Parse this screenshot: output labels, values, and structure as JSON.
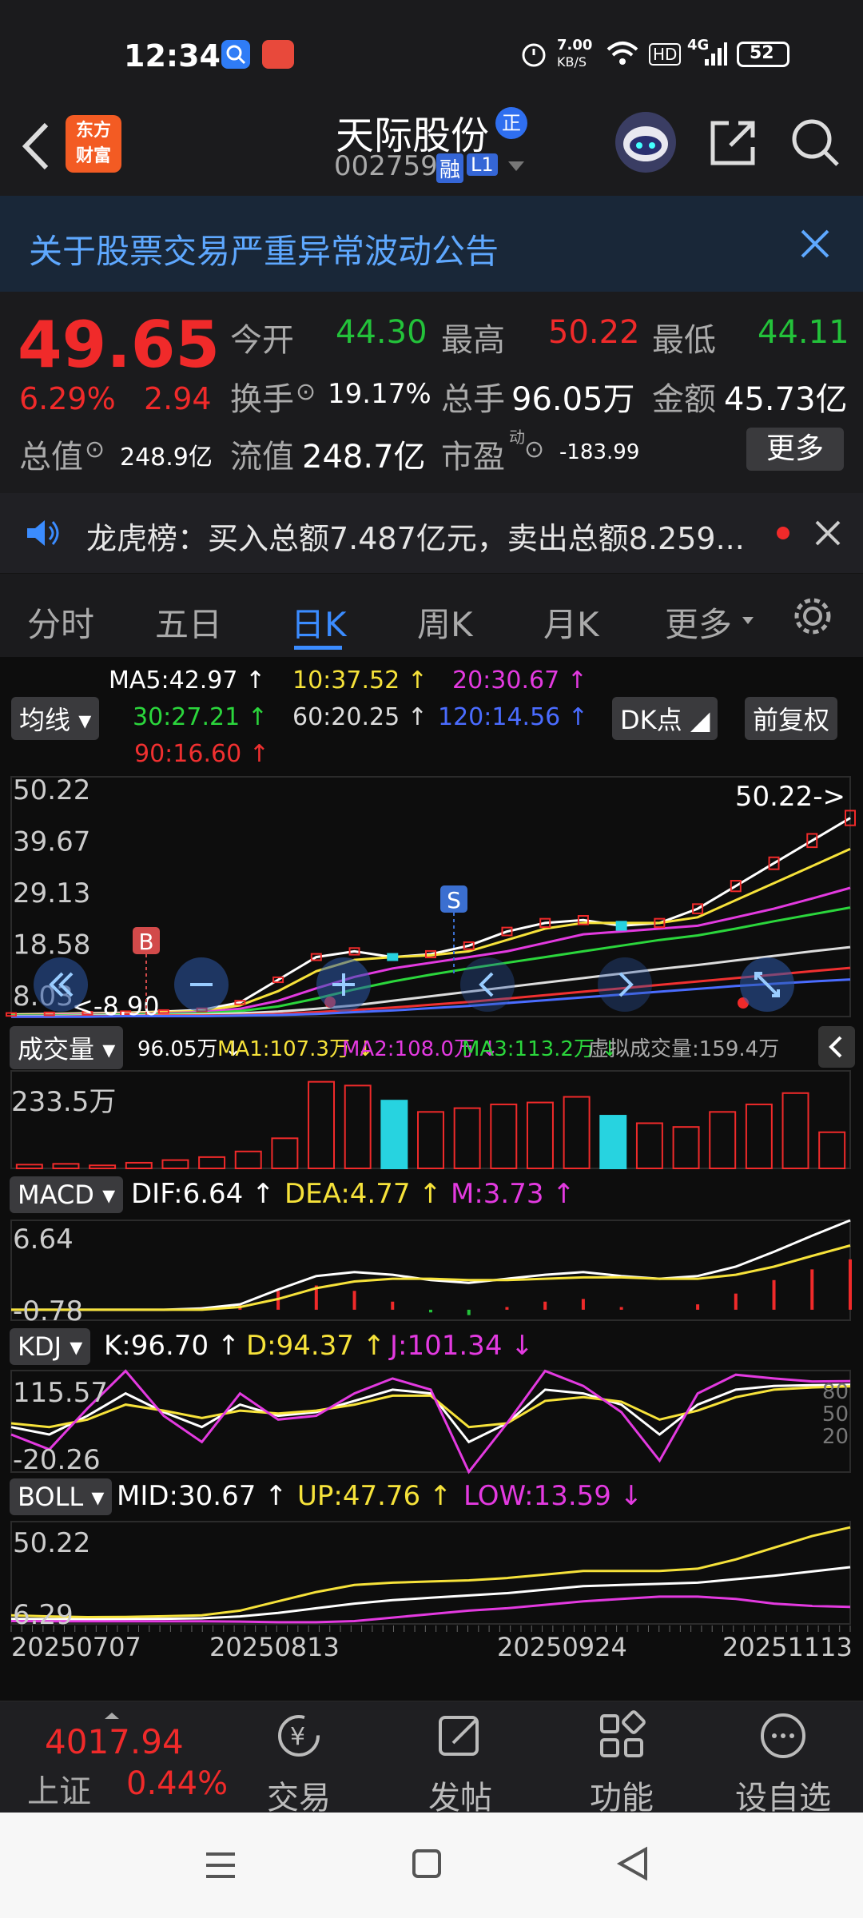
{
  "status_bar": {
    "time": "12:34",
    "net_speed_value": "7.00",
    "net_speed_unit": "KB/S",
    "battery": "52",
    "hd": "HD",
    "signal": "4G"
  },
  "header": {
    "logo_line1": "东方",
    "logo_line2": "财富",
    "title": "天际股份",
    "badge": "正",
    "code": "002759",
    "tag_margin": "融",
    "tag_level": "L1"
  },
  "notice": {
    "text": "关于股票交易严重异常波动公告"
  },
  "quote": {
    "price": "49.65",
    "change_pct": "6.29%",
    "change_amt": "2.94",
    "open_label": "今开",
    "open": "44.30",
    "high_label": "最高",
    "high": "50.22",
    "low_label": "最低",
    "low": "44.11",
    "turnover_label": "换手",
    "turnover": "19.17%",
    "volume_label": "总手",
    "volume": "96.05万",
    "amount_label": "金额",
    "amount": "45.73亿",
    "mktcap_label": "总值",
    "mktcap": "248.9亿",
    "float_label": "流值",
    "float": "248.7亿",
    "pe_label": "市盈",
    "pe_sup": "动",
    "pe": "-183.99",
    "more": "更多"
  },
  "dragon": {
    "text": "龙虎榜：买入总额7.487亿元，卖出总额8.259..."
  },
  "tabs": [
    "分时",
    "五日",
    "日K",
    "周K",
    "月K",
    "更多"
  ],
  "active_tab": 2,
  "chart_controls": {
    "ma_select": "均线",
    "dk": "DK点",
    "adjust": "前复权"
  },
  "ma_legend": {
    "ma5": "MA5:42.97 ↑",
    "ma10": "10:37.52 ↑",
    "ma20": "20:30.67 ↑",
    "ma30": "30:27.21 ↑",
    "ma60": "60:20.25 ↑",
    "ma120": "120:14.56 ↑",
    "ma90": "90:16.60 ↑"
  },
  "chart_data": [
    {
      "type": "line",
      "title": "日K",
      "yticks": [
        "50.22",
        "39.67",
        "29.13",
        "18.58",
        "8.03"
      ],
      "ylim": [
        8.03,
        50.22
      ],
      "x_dates": [
        "20250707",
        "20250813",
        "20250924",
        "20251113"
      ],
      "annotations": {
        "high_label": "50.22->",
        "low_label": "<-8.90",
        "buy_marker": "B",
        "sell_marker": "S"
      },
      "series": [
        {
          "name": "MA5",
          "values": [
            8.4,
            8.5,
            8.6,
            8.7,
            8.9,
            9.2,
            10.5,
            14.5,
            18.5,
            19.5,
            18.5,
            19.0,
            20.5,
            23.0,
            24.5,
            25.0,
            24.0,
            24.5,
            27.0,
            31.0,
            35.0,
            39.0,
            42.97
          ]
        },
        {
          "name": "MA10",
          "values": [
            8.3,
            8.4,
            8.5,
            8.6,
            8.8,
            9.0,
            10.0,
            12.5,
            16.0,
            18.0,
            18.5,
            18.8,
            19.5,
            21.5,
            23.5,
            24.5,
            24.5,
            24.5,
            25.5,
            28.5,
            31.5,
            34.5,
            37.52
          ]
        },
        {
          "name": "MA20",
          "values": [
            8.2,
            8.3,
            8.4,
            8.5,
            8.6,
            8.8,
            9.4,
            10.8,
            13.0,
            15.0,
            16.5,
            17.5,
            18.5,
            19.5,
            21.0,
            22.5,
            23.0,
            23.5,
            24.0,
            25.5,
            27.0,
            28.8,
            30.67
          ]
        },
        {
          "name": "MA30",
          "values": [
            8.2,
            8.2,
            8.3,
            8.4,
            8.5,
            8.6,
            9.0,
            9.8,
            11.2,
            12.8,
            14.2,
            15.4,
            16.5,
            17.5,
            18.5,
            19.5,
            20.5,
            21.5,
            22.3,
            23.5,
            24.8,
            26.0,
            27.21
          ]
        },
        {
          "name": "MA60",
          "values": [
            8.1,
            8.1,
            8.2,
            8.2,
            8.3,
            8.4,
            8.6,
            8.9,
            9.4,
            10.0,
            10.8,
            11.6,
            12.4,
            13.2,
            14.0,
            14.8,
            15.6,
            16.4,
            17.1,
            17.9,
            18.7,
            19.5,
            20.25
          ]
        },
        {
          "name": "MA90",
          "values": [
            8.0,
            8.0,
            8.1,
            8.1,
            8.2,
            8.2,
            8.3,
            8.5,
            8.8,
            9.2,
            9.6,
            10.1,
            10.6,
            11.2,
            11.8,
            12.4,
            13.0,
            13.6,
            14.2,
            14.8,
            15.4,
            16.0,
            16.6
          ]
        },
        {
          "name": "MA120",
          "values": [
            8.0,
            8.0,
            8.0,
            8.1,
            8.1,
            8.1,
            8.2,
            8.3,
            8.5,
            8.8,
            9.1,
            9.5,
            9.9,
            10.4,
            10.9,
            11.4,
            11.9,
            12.4,
            12.9,
            13.4,
            13.8,
            14.2,
            14.56
          ]
        }
      ]
    },
    {
      "type": "bar",
      "title": "成交量",
      "header": {
        "label": "成交量",
        "vol": "96.05万 ↓",
        "ma1": "MA1:107.3万 ↓",
        "ma2": "MA2:108.0万 ↓",
        "ma3": "MA3:113.2万 ↓",
        "virtual": "虚拟成交量:159.4万"
      },
      "ytick": "233.5万",
      "ylim": [
        0,
        233.5
      ],
      "values": [
        10,
        12,
        8,
        15,
        22,
        30,
        45,
        80,
        230,
        220,
        180,
        150,
        160,
        170,
        175,
        190,
        140,
        120,
        110,
        150,
        170,
        200,
        96.05
      ]
    },
    {
      "type": "line",
      "title": "MACD",
      "header": {
        "label": "MACD",
        "dif": "DIF:6.64 ↑",
        "dea": "DEA:4.77 ↑",
        "m": "M:3.73 ↑"
      },
      "yticks": [
        "6.64",
        "-0.78"
      ],
      "ylim": [
        -0.78,
        6.64
      ],
      "series": [
        {
          "name": "DIF",
          "values": [
            0,
            0,
            0,
            0,
            0,
            0.1,
            0.4,
            1.5,
            2.5,
            2.8,
            2.6,
            2.2,
            2.0,
            2.3,
            2.6,
            2.8,
            2.5,
            2.3,
            2.5,
            3.2,
            4.3,
            5.5,
            6.64
          ]
        },
        {
          "name": "DEA",
          "values": [
            0,
            0,
            0,
            0,
            0,
            0,
            0.2,
            0.8,
            1.6,
            2.1,
            2.3,
            2.3,
            2.2,
            2.2,
            2.3,
            2.4,
            2.4,
            2.3,
            2.3,
            2.6,
            3.2,
            4.0,
            4.77
          ]
        }
      ]
    },
    {
      "type": "line",
      "title": "KDJ",
      "header": {
        "label": "KDJ",
        "k": "K:96.70 ↑",
        "d": "D:94.37 ↑",
        "j": "J:101.34 ↓"
      },
      "yticks": [
        "115.57",
        "-20.26"
      ],
      "right_ticks": [
        "80",
        "50",
        "20"
      ],
      "ylim": [
        -20.26,
        115.57
      ],
      "series": [
        {
          "name": "K",
          "values": [
            40,
            30,
            55,
            85,
            60,
            40,
            70,
            55,
            60,
            75,
            90,
            85,
            20,
            45,
            90,
            85,
            70,
            30,
            70,
            90,
            95,
            96,
            96.7
          ]
        },
        {
          "name": "D",
          "values": [
            45,
            40,
            50,
            70,
            62,
            52,
            62,
            58,
            62,
            70,
            82,
            82,
            40,
            45,
            75,
            80,
            74,
            50,
            62,
            80,
            90,
            93,
            94.37
          ]
        },
        {
          "name": "J",
          "values": [
            30,
            10,
            65,
            115,
            55,
            20,
            85,
            50,
            55,
            85,
            105,
            90,
            -20,
            45,
            115,
            95,
            60,
            -5,
            85,
            110,
            105,
            101,
            101.34
          ]
        }
      ]
    },
    {
      "type": "line",
      "title": "BOLL",
      "header": {
        "label": "BOLL",
        "mid": "MID:30.67 ↑",
        "up": "UP:47.76 ↑",
        "low": "LOW:13.59 ↓"
      },
      "yticks": [
        "50.22",
        "6.29"
      ],
      "ylim": [
        6.29,
        50.22
      ],
      "series": [
        {
          "name": "MID",
          "values": [
            8.5,
            8.4,
            8.3,
            8.4,
            8.5,
            8.7,
            9.5,
            11,
            13,
            15,
            16.5,
            17.5,
            18.5,
            19.5,
            21,
            22.5,
            23,
            23.5,
            24,
            25.5,
            27,
            28.8,
            30.67
          ]
        },
        {
          "name": "UP",
          "values": [
            10,
            9.5,
            9.2,
            9.3,
            9.6,
            10,
            12,
            16,
            20,
            23,
            24,
            24.5,
            25,
            26,
            27.5,
            29,
            29,
            29,
            30,
            34,
            39,
            44,
            47.76
          ]
        },
        {
          "name": "LOW",
          "values": [
            7.5,
            7.4,
            7.4,
            7.4,
            7.4,
            7.4,
            7.3,
            7.0,
            7.0,
            7.5,
            9,
            10.5,
            12,
            13,
            14.5,
            16,
            17,
            18,
            18,
            17,
            15,
            14,
            13.59
          ]
        }
      ]
    }
  ],
  "bottom_nav": {
    "index_value": "4017.94",
    "index_name": "上证",
    "index_pct": "0.44%",
    "items": [
      "交易",
      "发帖",
      "功能",
      "设自选"
    ]
  }
}
